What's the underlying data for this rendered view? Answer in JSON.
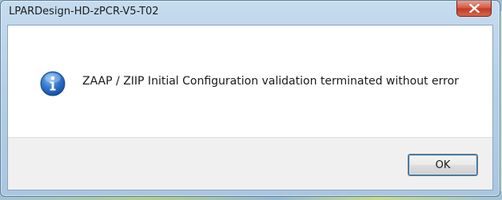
{
  "window": {
    "title": "LPARDesign-HD-zPCR-V5-T02",
    "close_icon": "close-icon"
  },
  "message": {
    "icon": "info-icon",
    "text": "ZAAP / ZIIP Initial Configuration validation terminated without error"
  },
  "buttons": {
    "ok_label": "OK"
  },
  "colors": {
    "close_button": "#c23a22",
    "info_icon": "#1f63b8",
    "frame": "#b4cfe7"
  }
}
